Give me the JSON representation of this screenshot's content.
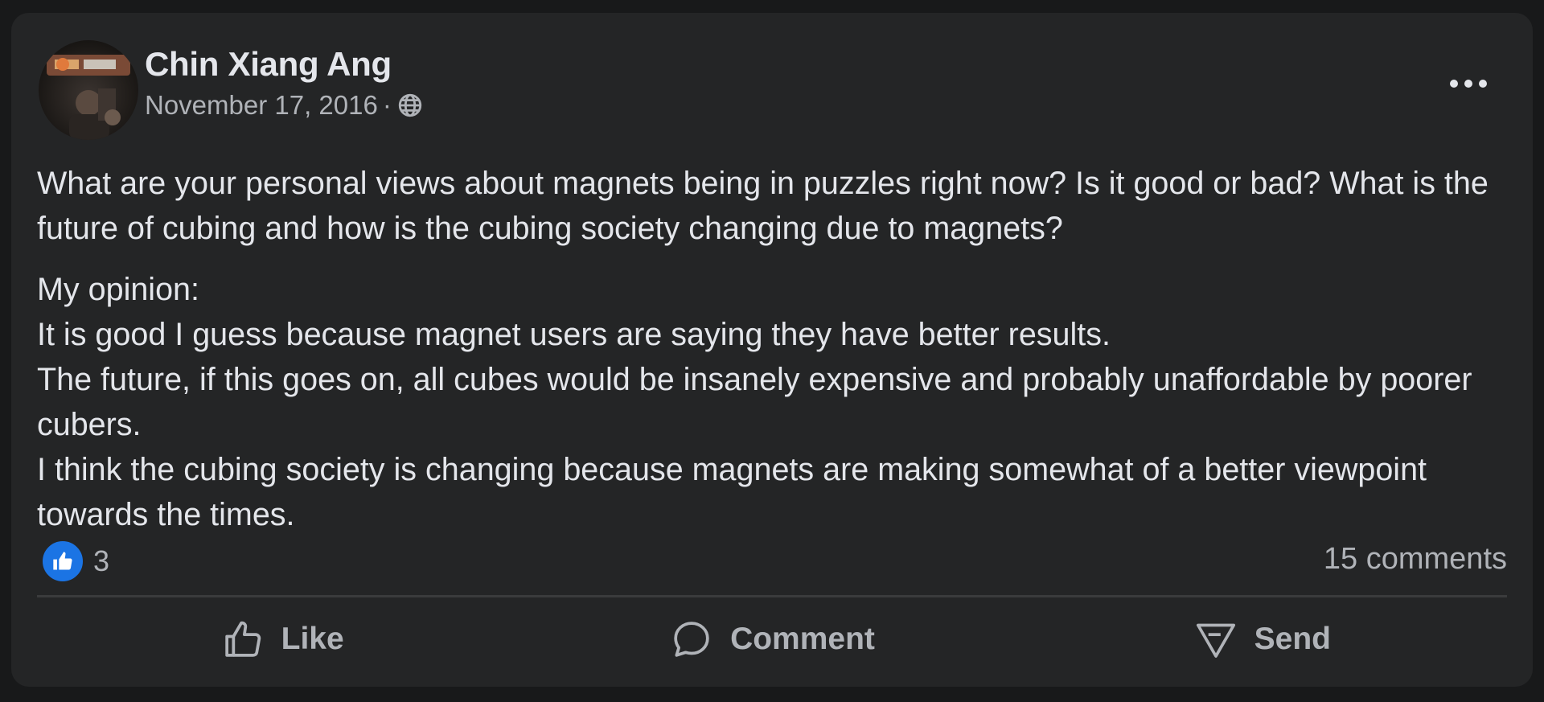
{
  "post": {
    "author": "Chin Xiang Ang",
    "date": "November 17, 2016",
    "separator": "·",
    "privacy_icon": "globe-icon",
    "more_icon": "more-options-icon",
    "paragraphs": [
      "What are your personal views about magnets being in puzzles right now? Is it good or bad? What is the future of cubing and how is the cubing society changing due to magnets?",
      "My opinion:\nIt is good I guess because magnet users are saying they have better results.\nThe future, if this goes on, all cubes would be insanely expensive and probably unaffordable by poorer cubers.\nI think the cubing society is changing because magnets are making somewhat of a better viewpoint towards the times."
    ]
  },
  "engagement": {
    "reaction_icon": "like-reaction-icon",
    "reaction_count": "3",
    "comments": "15 comments"
  },
  "actions": {
    "like": "Like",
    "comment": "Comment",
    "send": "Send"
  },
  "colors": {
    "background": "#18191a",
    "card": "#242526",
    "text": "#e4e6eb",
    "muted_text": "#b0b3b8",
    "like_blue": "#1b74e4",
    "divider": "#3a3b3c"
  }
}
